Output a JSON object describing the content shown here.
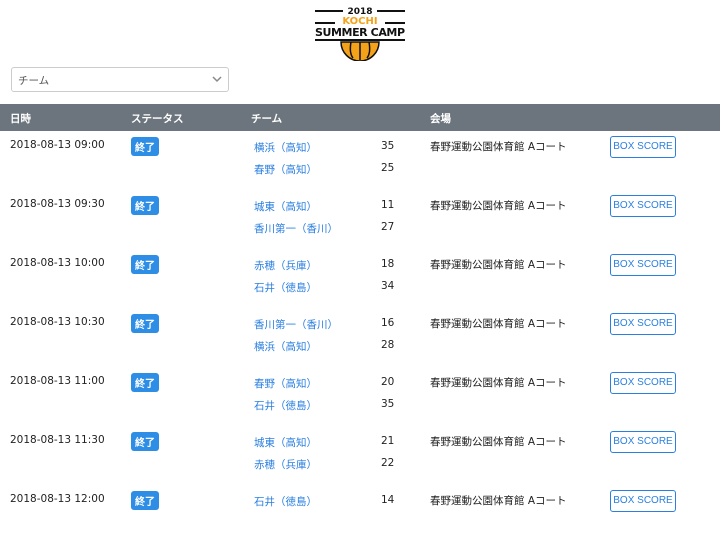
{
  "logo": {
    "year": "2018",
    "line1": "KOCHI",
    "line2": "SUMMER CAMP"
  },
  "filter": {
    "placeholder": "チーム"
  },
  "headers": [
    "日時",
    "ステータス",
    "チーム",
    "会場"
  ],
  "games": [
    {
      "datetime": "2018-08-13 09:00",
      "status": "終了",
      "team1": "横浜（高知）",
      "score1": "35",
      "team2": "春野（高知）",
      "score2": "25",
      "venue": "春野運動公園体育館 Aコート",
      "button": "BOX SCORE"
    },
    {
      "datetime": "2018-08-13 09:30",
      "status": "終了",
      "team1": "城東（高知）",
      "score1": "11",
      "team2": "香川第一（香川）",
      "score2": "27",
      "venue": "春野運動公園体育館 Aコート",
      "button": "BOX SCORE"
    },
    {
      "datetime": "2018-08-13 10:00",
      "status": "終了",
      "team1": "赤穂（兵庫）",
      "score1": "18",
      "team2": "石井（徳島）",
      "score2": "34",
      "venue": "春野運動公園体育館 Aコート",
      "button": "BOX SCORE"
    },
    {
      "datetime": "2018-08-13 10:30",
      "status": "終了",
      "team1": "香川第一（香川）",
      "score1": "16",
      "team2": "横浜（高知）",
      "score2": "28",
      "venue": "春野運動公園体育館 Aコート",
      "button": "BOX SCORE"
    },
    {
      "datetime": "2018-08-13 11:00",
      "status": "終了",
      "team1": "春野（高知）",
      "score1": "20",
      "team2": "石井（徳島）",
      "score2": "35",
      "venue": "春野運動公園体育館 Aコート",
      "button": "BOX SCORE"
    },
    {
      "datetime": "2018-08-13 11:30",
      "status": "終了",
      "team1": "城東（高知）",
      "score1": "21",
      "team2": "赤穂（兵庫）",
      "score2": "22",
      "venue": "春野運動公園体育館 Aコート",
      "button": "BOX SCORE"
    },
    {
      "datetime": "2018-08-13 12:00",
      "status": "終了",
      "team1": "石井（徳島）",
      "score1": "14",
      "team2": "",
      "score2": "",
      "venue": "春野運動公園体育館 Aコート",
      "button": "BOX SCORE"
    }
  ]
}
